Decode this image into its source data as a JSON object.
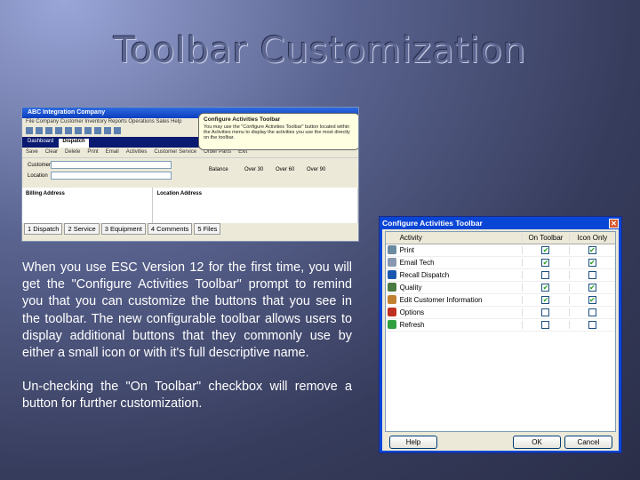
{
  "slide": {
    "title": "Toolbar Customization",
    "paragraphs": [
      "When you use ESC Version 12 for the first time, you will get the \"Configure Activities Toolbar\" prompt to remind you that you can customize the buttons that you see in the toolbar. The new configurable toolbar allows users to display additional buttons that they commonly use by either a small icon or with it's full descriptive name.",
      "Un-checking the \"On Toolbar\" checkbox will remove a button for further customization."
    ]
  },
  "app": {
    "title": "ABC Integration Company",
    "menu": "File  Company  Customer  Inventory  Reports  Operations  Sales  Help",
    "tabs": [
      "Dashboard",
      "Dispatch"
    ],
    "tools": [
      "Save",
      "Clear",
      "Delete",
      "Print",
      "Email",
      "Activities",
      "Customer Service",
      "Order Parts",
      "Exit"
    ],
    "labels": {
      "customer": "Customer",
      "location": "Location",
      "balance": "Balance",
      "over30": "Over 30",
      "over60": "Over 60",
      "over90": "Over 90",
      "billing": "Billing Address",
      "loc_addr": "Location Address"
    },
    "bottom_tabs": [
      "1 Dispatch",
      "2 Service",
      "3 Equipment",
      "4 Comments",
      "5 Files"
    ],
    "tooltip": {
      "title": "Configure Activities Toolbar",
      "text": "You may use the \"Configure Activities Toolbar\" button located within the Activities menu to display the activities you use the most directly on the toolbar."
    }
  },
  "dialog": {
    "title": "Configure Activities Toolbar",
    "columns": [
      "Activity",
      "On Toolbar",
      "Icon Only"
    ],
    "rows": [
      {
        "name": "Print",
        "on": true,
        "icon": true,
        "color": "#6a8aa0"
      },
      {
        "name": "Email Tech",
        "on": true,
        "icon": true,
        "color": "#8898b0"
      },
      {
        "name": "Recall Dispatch",
        "on": false,
        "icon": false,
        "color": "#1a58b0"
      },
      {
        "name": "Quality",
        "on": true,
        "icon": true,
        "color": "#4a7a40"
      },
      {
        "name": "Edit Customer Information",
        "on": true,
        "icon": true,
        "color": "#c08030"
      },
      {
        "name": "Options",
        "on": false,
        "icon": false,
        "color": "#c03020"
      },
      {
        "name": "Refresh",
        "on": false,
        "icon": false,
        "color": "#30a040"
      }
    ],
    "buttons": {
      "help": "Help",
      "ok": "OK",
      "cancel": "Cancel"
    }
  }
}
